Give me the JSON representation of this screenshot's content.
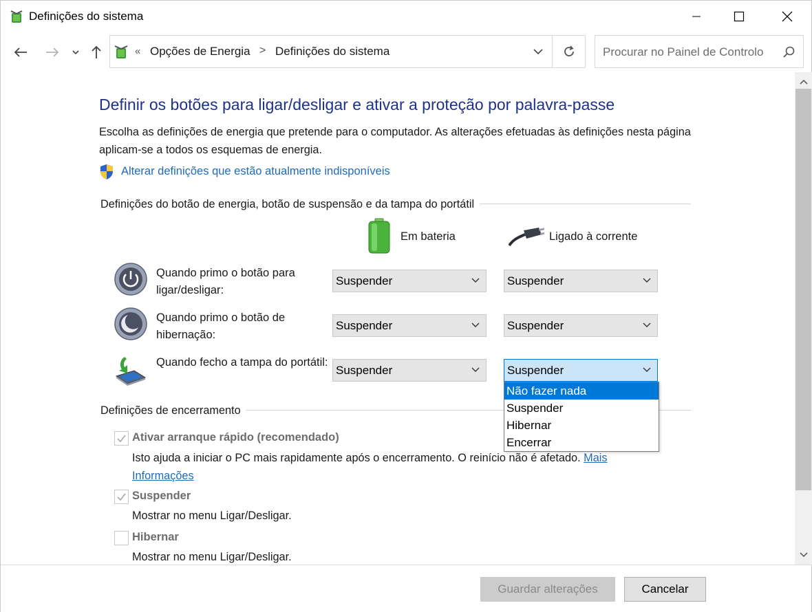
{
  "window": {
    "title": "Definições do sistema",
    "controls": {
      "minimize_icon": "minimize-icon",
      "maximize_icon": "maximize-icon",
      "close_icon": "close-icon"
    }
  },
  "nav": {
    "address": {
      "overflow_chevron": "«",
      "crumbs": [
        "Opções de Energia",
        "Definições do sistema"
      ],
      "separator": ">"
    },
    "search": {
      "placeholder": "Procurar no Painel de Controlo"
    }
  },
  "main": {
    "heading": "Definir os botões para ligar/desligar e ativar a proteção por palavra-passe",
    "description": "Escolha as definições de energia que pretende para o computador. As alterações efetuadas às definições nesta página aplicam-se a todos os esquemas de energia.",
    "change_link": "Alterar definições que estão atualmente indisponíveis",
    "power_group": {
      "title": "Definições do botão de energia, botão de suspensão e da tampa do portátil",
      "columns": [
        "Em bateria",
        "Ligado à corrente"
      ],
      "rows": [
        {
          "label": "Quando primo o botão para ligar/desligar:",
          "battery": "Suspender",
          "plugged": "Suspender"
        },
        {
          "label": "Quando primo o botão de hibernação:",
          "battery": "Suspender",
          "plugged": "Suspender"
        },
        {
          "label": "Quando fecho a tampa do portátil:",
          "battery": "Suspender",
          "plugged": "Suspender"
        }
      ],
      "open_dropdown": {
        "options": [
          "Não fazer nada",
          "Suspender",
          "Hibernar",
          "Encerrar"
        ],
        "highlighted": "Não fazer nada"
      }
    },
    "shutdown_group": {
      "title": "Definições de encerramento",
      "items": [
        {
          "label": "Ativar arranque rápido (recomendado)",
          "checked": true,
          "desc": "Isto ajuda a iniciar o PC mais rapidamente após o encerramento. O reinício não é afetado.",
          "link_part1": "Mais",
          "link_part2": "Informações"
        },
        {
          "label": "Suspender",
          "checked": true,
          "desc": "Mostrar no menu Ligar/Desligar."
        },
        {
          "label": "Hibernar",
          "checked": false,
          "desc": "Mostrar no menu Ligar/Desligar."
        }
      ]
    }
  },
  "footer": {
    "save_label": "Guardar alterações",
    "cancel_label": "Cancelar"
  },
  "colors": {
    "heading": "#1e3287",
    "link": "#1f6bb5",
    "select_bg": "#e5e5e5",
    "focus_bg": "#cce4f7",
    "accent": "#0078d7"
  }
}
